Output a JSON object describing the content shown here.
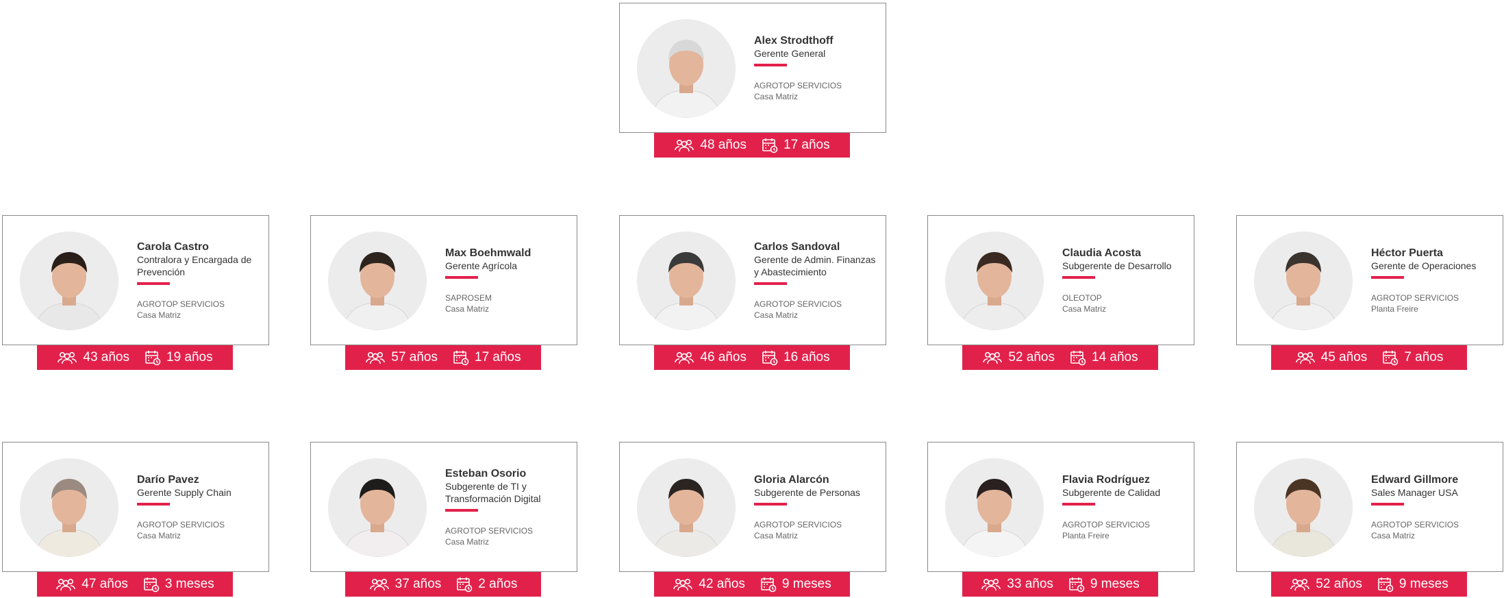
{
  "accent_color": "#e2214b",
  "age_icon": "people-group-icon",
  "tenure_icon": "calendar-clock-icon",
  "people": [
    {
      "name": "Alex Strodthoff",
      "role": "Gerente General",
      "company": "AGROTOP SERVICIOS",
      "location": "Casa Matriz",
      "age": "48 años",
      "tenure": "17 años"
    },
    {
      "name": "Carola Castro",
      "role": "Contralora y Encargada de Prevención",
      "company": "AGROTOP SERVICIOS",
      "location": "Casa Matriz",
      "age": "43 años",
      "tenure": "19 años"
    },
    {
      "name": "Max Boehmwald",
      "role": "Gerente Agrícola",
      "company": "SAPROSEM",
      "location": "Casa Matriz",
      "age": "57 años",
      "tenure": "17 años"
    },
    {
      "name": "Carlos Sandoval",
      "role": "Gerente de Admin. Finanzas y Abastecimiento",
      "company": "AGROTOP SERVICIOS",
      "location": "Casa Matriz",
      "age": "46 años",
      "tenure": "16 años"
    },
    {
      "name": "Claudia Acosta",
      "role": "Subgerente de Desarrollo",
      "company": "OLEOTOP",
      "location": "Casa Matriz",
      "age": "52 años",
      "tenure": "14 años"
    },
    {
      "name": "Héctor Puerta",
      "role": "Gerente de Operaciones",
      "company": "AGROTOP SERVICIOS",
      "location": "Planta Freire",
      "age": "45 años",
      "tenure": "7 años"
    },
    {
      "name": "Darío Pavez",
      "role": "Gerente Supply Chain",
      "company": "AGROTOP SERVICIOS",
      "location": "Casa Matriz",
      "age": "47 años",
      "tenure": "3 meses"
    },
    {
      "name": "Esteban Osorio",
      "role": "Subgerente de TI y Transformación Digital",
      "company": "AGROTOP SERVICIOS",
      "location": "Casa Matriz",
      "age": "37 años",
      "tenure": "2 años"
    },
    {
      "name": "Gloria Alarcón",
      "role": "Subgerente de Personas",
      "company": "AGROTOP SERVICIOS",
      "location": "Casa Matriz",
      "age": "42 años",
      "tenure": "9 meses"
    },
    {
      "name": "Flavia Rodríguez",
      "role": "Subgerente de Calidad",
      "company": "AGROTOP SERVICIOS",
      "location": "Planta Freire",
      "age": "33 años",
      "tenure": "9 meses"
    },
    {
      "name": "Edward Gillmore",
      "role": "Sales Manager USA",
      "company": "AGROTOP SERVICIOS",
      "location": "Casa Matriz",
      "age": "52 años",
      "tenure": "9 meses"
    }
  ]
}
